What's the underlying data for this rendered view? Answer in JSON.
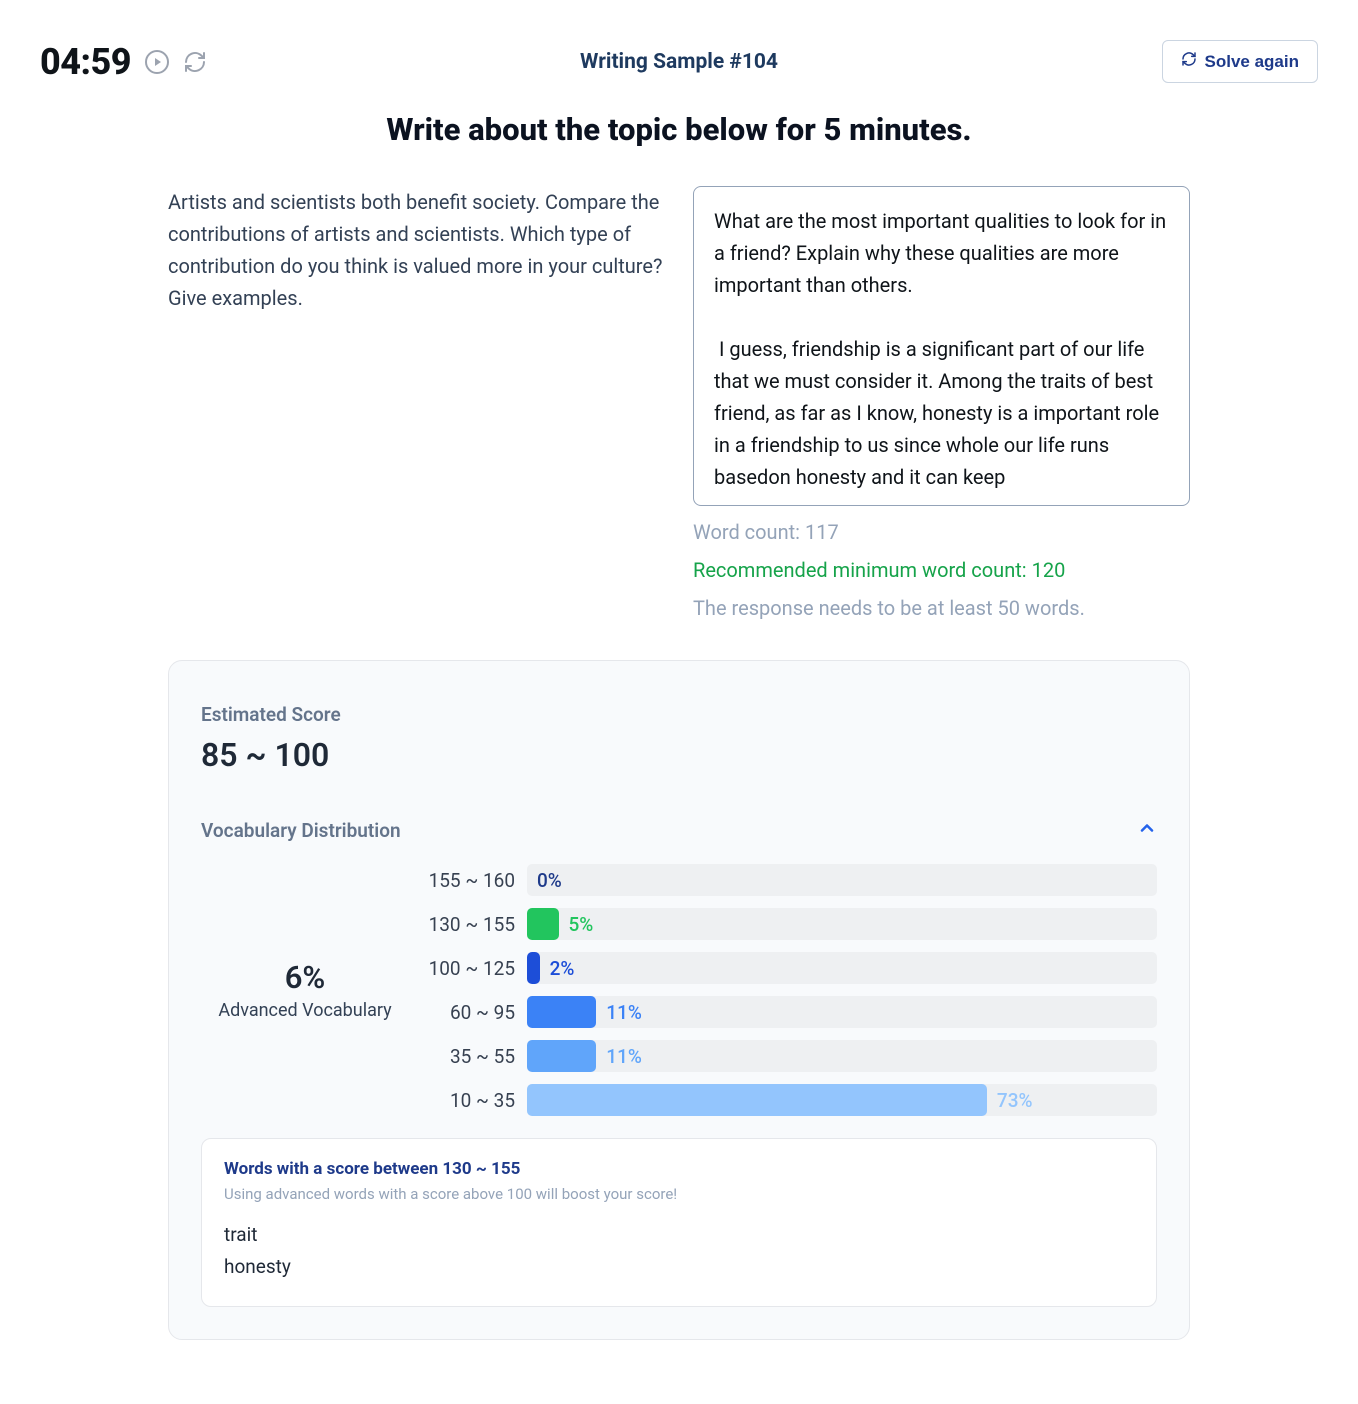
{
  "header": {
    "timer": "04:59",
    "title": "Writing Sample #104",
    "solve_label": "Solve again"
  },
  "prompt_heading": "Write about the topic below for 5 minutes.",
  "prompt_text": "Artists and scientists both benefit society. Compare the contributions of artists and scientists. Which type of contribution do you think is valued more in your culture? Give examples.",
  "answer_text": "What are the most important qualities to look for in a friend? Explain why these qualities are more important than others.\n\n I guess, friendship is a significant part of our life that we must consider it. Among the traits of best friend, as far as I know, honesty is a important role in a friendship to us since whole our life runs basedon honesty and it can keep",
  "meta": {
    "word_count_label": "Word count: 117",
    "recommended_label": "Recommended minimum word count: 120",
    "min_words_label": "The response needs to be at least 50 words."
  },
  "score": {
    "title": "Estimated Score",
    "range": "85 ~ 100",
    "vocab_title": "Vocabulary Distribution",
    "advanced_pct": "6%",
    "advanced_label": "Advanced Vocabulary"
  },
  "chart_data": {
    "type": "bar",
    "title": "Vocabulary Distribution",
    "xlabel": "",
    "ylabel": "",
    "categories": [
      "155 ~ 160",
      "130 ~ 155",
      "100 ~ 125",
      "60 ~ 95",
      "35 ~ 55",
      "10 ~ 35"
    ],
    "values": [
      0,
      5,
      2,
      11,
      11,
      73
    ],
    "value_labels": [
      "0%",
      "5%",
      "2%",
      "11%",
      "11%",
      "73%"
    ],
    "colors": [
      "#1e3a8a",
      "#22c55e",
      "#1d4ed8",
      "#3b82f6",
      "#60a5fa",
      "#93c5fd"
    ],
    "label_colors": [
      "#1e3a8a",
      "#22c55e",
      "#1d4ed8",
      "#3b82f6",
      "#60a5fa",
      "#93c5fd"
    ],
    "xlim": [
      0,
      100
    ]
  },
  "tip": {
    "title": "Words with a score between 130 ~ 155",
    "subtitle": "Using advanced words with a score above 100 will boost your score!",
    "words": [
      "trait",
      "honesty"
    ]
  }
}
